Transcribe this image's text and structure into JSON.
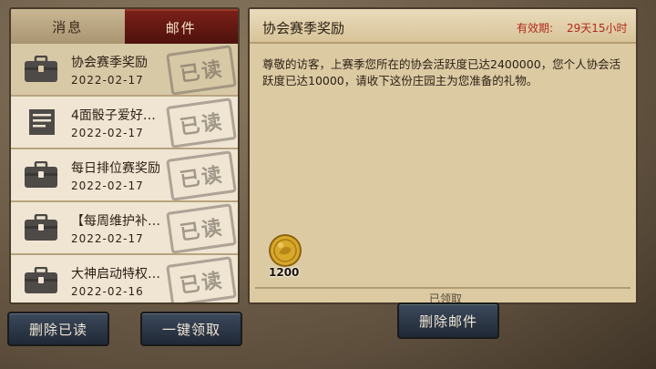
{
  "tabs": {
    "messages": "消息",
    "mail": "邮件"
  },
  "mail_list": [
    {
      "title": "协会赛季奖励",
      "date": "2022-02-17",
      "icon": "briefcase-icon",
      "stamp": "已读",
      "selected": true
    },
    {
      "title": "4面骰子爱好…",
      "date": "2022-02-17",
      "icon": "document-icon",
      "stamp": "已读",
      "selected": false
    },
    {
      "title": "每日排位赛奖励",
      "date": "2022-02-17",
      "icon": "briefcase-icon",
      "stamp": "已读",
      "selected": false
    },
    {
      "title": "【每周维护补…",
      "date": "2022-02-17",
      "icon": "briefcase-icon",
      "stamp": "已读",
      "selected": false
    },
    {
      "title": "大神启动特权…",
      "date": "2022-02-16",
      "icon": "briefcase-icon",
      "stamp": "已读",
      "selected": false
    }
  ],
  "buttons": {
    "delete_read": "删除已读",
    "claim_all": "一键领取",
    "delete_mail": "删除邮件"
  },
  "detail": {
    "title": "协会赛季奖励",
    "expire_label": "有效期:",
    "expire_value": "29天15小时",
    "body": "尊敬的访客，上赛季您所在的协会活跃度已达2400000，您个人协会活跃度已达10000，请收下这份庄园主为您准备的礼物。",
    "reward_count": "1200",
    "claimed_status": "已领取"
  },
  "colors": {
    "active_tab": "#7a1f18",
    "expire_text": "#b02a1e",
    "button_bg": "#2c3644"
  }
}
